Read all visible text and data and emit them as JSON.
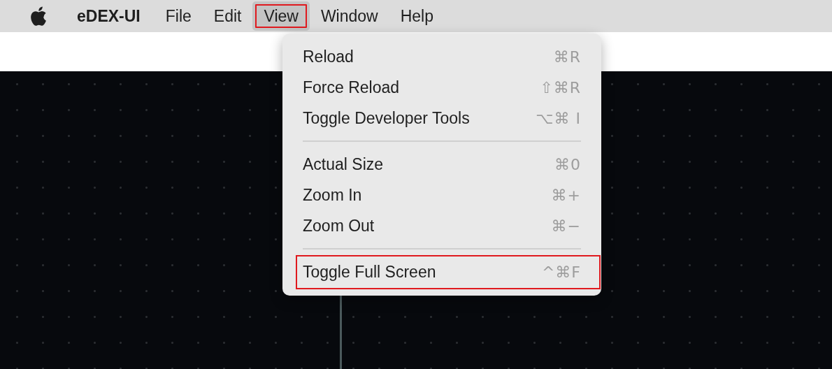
{
  "menu_bar": {
    "app_name": "eDEX-UI",
    "items": [
      {
        "label": "File",
        "selected": false,
        "annotated": false
      },
      {
        "label": "Edit",
        "selected": false,
        "annotated": false
      },
      {
        "label": "View",
        "selected": true,
        "annotated": true
      },
      {
        "label": "Window",
        "selected": false,
        "annotated": false
      },
      {
        "label": "Help",
        "selected": false,
        "annotated": false
      }
    ]
  },
  "menu": {
    "items": [
      {
        "kind": "item",
        "label": "Reload",
        "shortcut": "⌘R",
        "annotated": false
      },
      {
        "kind": "item",
        "label": "Force Reload",
        "shortcut": "⇧⌘R",
        "annotated": false
      },
      {
        "kind": "item",
        "label": "Toggle Developer Tools",
        "shortcut": "⌥⌘ I",
        "annotated": false
      },
      {
        "kind": "separator"
      },
      {
        "kind": "item",
        "label": "Actual Size",
        "shortcut": "⌘0",
        "annotated": false
      },
      {
        "kind": "item",
        "label": "Zoom In",
        "shortcut": "⌘+",
        "annotated": false
      },
      {
        "kind": "item",
        "label": "Zoom Out",
        "shortcut": "⌘−",
        "annotated": false
      },
      {
        "kind": "separator"
      },
      {
        "kind": "item",
        "label": "Toggle Full Screen",
        "shortcut": "^⌘F",
        "annotated": true
      }
    ]
  }
}
